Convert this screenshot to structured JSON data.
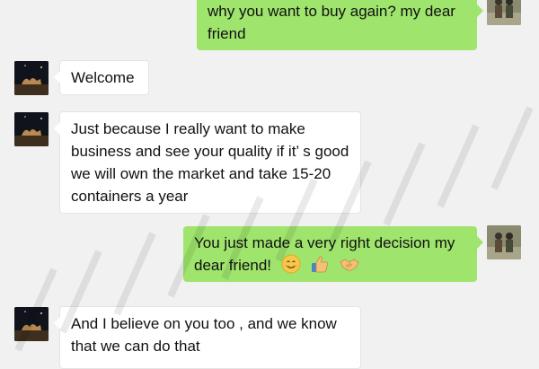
{
  "messages": [
    {
      "side": "out",
      "text": "why you want to buy again? my dear friend"
    },
    {
      "side": "in",
      "text": "Welcome"
    },
    {
      "side": "in",
      "text": "Just because I really want to make business and see your quality if it’ s good we will own the market and take 15-20 containers a year"
    },
    {
      "side": "out",
      "text": "You just made a very right decision my dear friend!",
      "emojis": [
        "smile-emoji",
        "thumbs-up-emoji",
        "handshake-emoji"
      ]
    },
    {
      "side": "in",
      "text": "And I believe on you too , and we know that we can do that"
    }
  ],
  "colors": {
    "background": "#f1f1f1",
    "incoming_bubble": "#ffffff",
    "outgoing_bubble": "#9fe46c"
  }
}
